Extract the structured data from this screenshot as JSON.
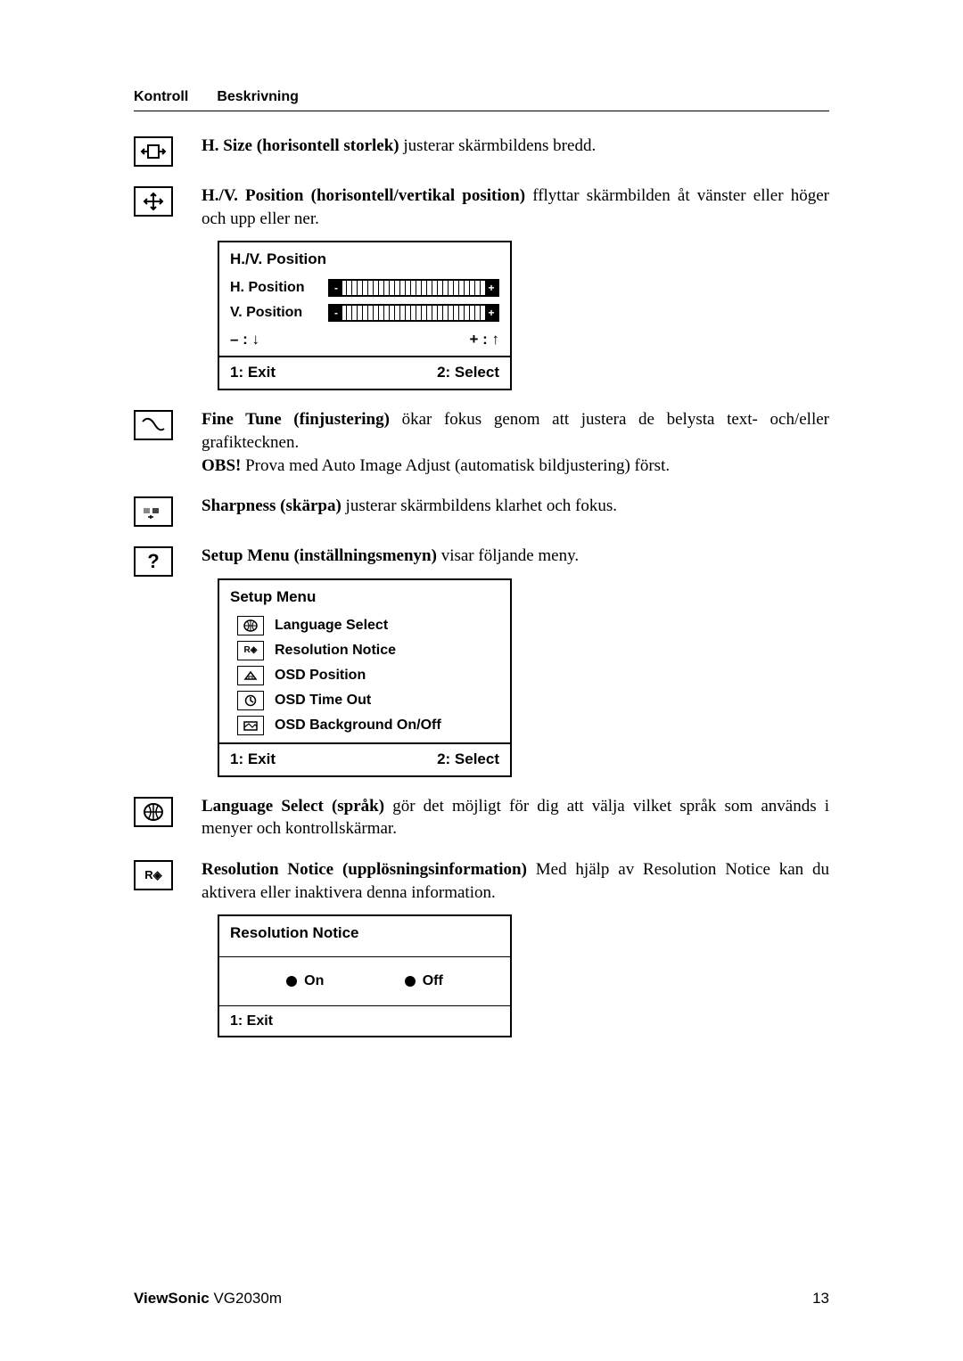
{
  "header": {
    "col1": "Kontroll",
    "col2": "Beskrivning"
  },
  "entries": {
    "hsize": {
      "title": "H. Size (horisontell storlek)",
      "text": " justerar skärmbildens bredd."
    },
    "hvpos": {
      "title": "H./V. Position (horisontell/vertikal position)",
      "text": " fflyttar skärmbilden åt vänster eller höger och upp eller ner."
    },
    "finetune": {
      "title": "Fine Tune (finjustering)",
      "text": " ökar fokus genom att justera de belysta text- och/eller grafiktecknen.",
      "note_title": "OBS!",
      "note_text": " Prova med Auto Image Adjust (automatisk bildjustering) först."
    },
    "sharpness": {
      "title": "Sharpness (skärpa)",
      "text": " justerar skärmbildens klarhet och fokus."
    },
    "setup": {
      "title": "Setup Menu (inställningsmenyn)",
      "text": " visar följande meny."
    },
    "language": {
      "title": "Language Select (språk)",
      "text": " gör det möjligt för dig att välja vilket språk som används i menyer och kontrollskärmar."
    },
    "resnotice": {
      "title": "Resolution Notice (upplösningsinformation)",
      "text": " Med hjälp av Resolution Notice kan du aktivera eller inaktivera denna information."
    }
  },
  "osd_hv": {
    "title": "H./V. Position",
    "row1": "H. Position",
    "row2": "V. Position",
    "minus": "– : ↓",
    "plus": "+ : ↑",
    "exit": "1: Exit",
    "select": "2: Select"
  },
  "osd_setup": {
    "title": "Setup Menu",
    "items": [
      "Language Select",
      "Resolution Notice",
      "OSD Position",
      "OSD Time Out",
      "OSD Background On/Off"
    ],
    "exit": "1: Exit",
    "select": "2: Select"
  },
  "osd_res": {
    "title": "Resolution Notice",
    "on": "On",
    "off": "Off",
    "exit": "1: Exit"
  },
  "icons": {
    "hsize": "↔▢↔",
    "hvpos": "⤡",
    "finetune": "∿",
    "sharpness": "▪▪",
    "setup": "?",
    "language": "🌐",
    "resnotice": "R◈"
  },
  "mini_icons": {
    "lang": "🌐",
    "res": "R◈",
    "pos": "◇",
    "time": "◷",
    "bg": "◈"
  },
  "footer": {
    "brand": "ViewSonic",
    "model": " VG2030m",
    "page": "13"
  }
}
